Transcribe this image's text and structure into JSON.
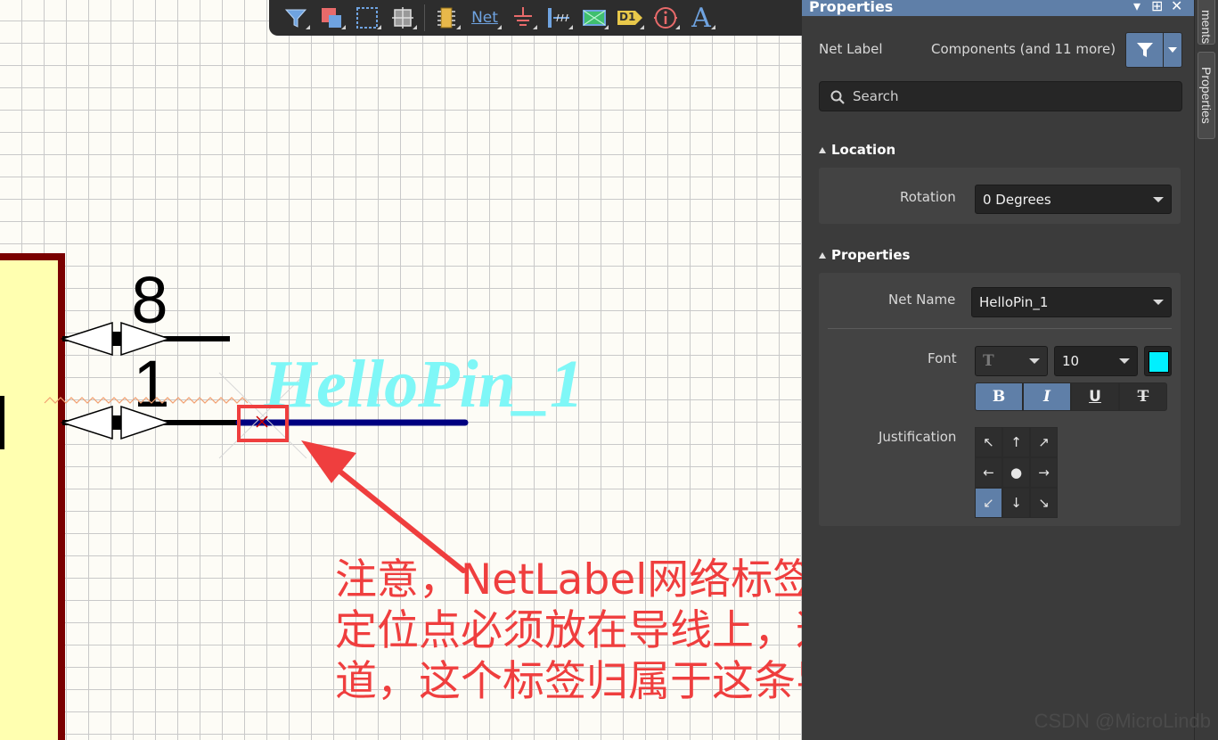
{
  "schematic": {
    "pin_numbers": [
      "8",
      "1"
    ],
    "net_label_text": "HelloPin_1",
    "colors": {
      "net_label": "#7ff7f7",
      "wire": "#000080",
      "component_border": "#7a0000",
      "component_fill": "#ffffb0",
      "annotation": "#ef3e3e"
    }
  },
  "toolbar": {
    "icons": [
      "filter-icon",
      "select-area-icon",
      "select-dashed-icon",
      "move-icon",
      "component-icon",
      "net-label-icon",
      "ground-icon",
      "bus-icon",
      "harness-icon",
      "designator-icon",
      "info-icon",
      "text-icon"
    ],
    "net_label_text": "Net",
    "designator_text": "D1",
    "text_tool": "A"
  },
  "annotation": {
    "line1": "注意，NetLabel网络标签左下角的这个",
    "line2": "定位点必须放在导线上，这样AD才知",
    "line3": "道，这个标签归属于这条导线"
  },
  "watermark": "CSDN @MicroLindb",
  "panel": {
    "title": "Properties",
    "object_type": "Net Label",
    "filter_scope": "Components (and 11 more)",
    "search_placeholder": "Search",
    "location": {
      "header": "Location",
      "rotation_label": "Rotation",
      "rotation_value": "0 Degrees"
    },
    "properties": {
      "header": "Properties",
      "net_name_label": "Net Name",
      "net_name_value": "HelloPin_1",
      "font_label": "Font",
      "font_face": "T",
      "font_size": "10",
      "font_color": "#00f0ff",
      "bold": "B",
      "italic": "I",
      "underline": "U",
      "strike": "T",
      "justification_label": "Justification",
      "justification_cells": [
        "↖",
        "↑",
        "↗",
        "←",
        "●",
        "→",
        "↙",
        "↓",
        "↘"
      ]
    }
  },
  "side_tabs": [
    "ments",
    "Properties"
  ]
}
